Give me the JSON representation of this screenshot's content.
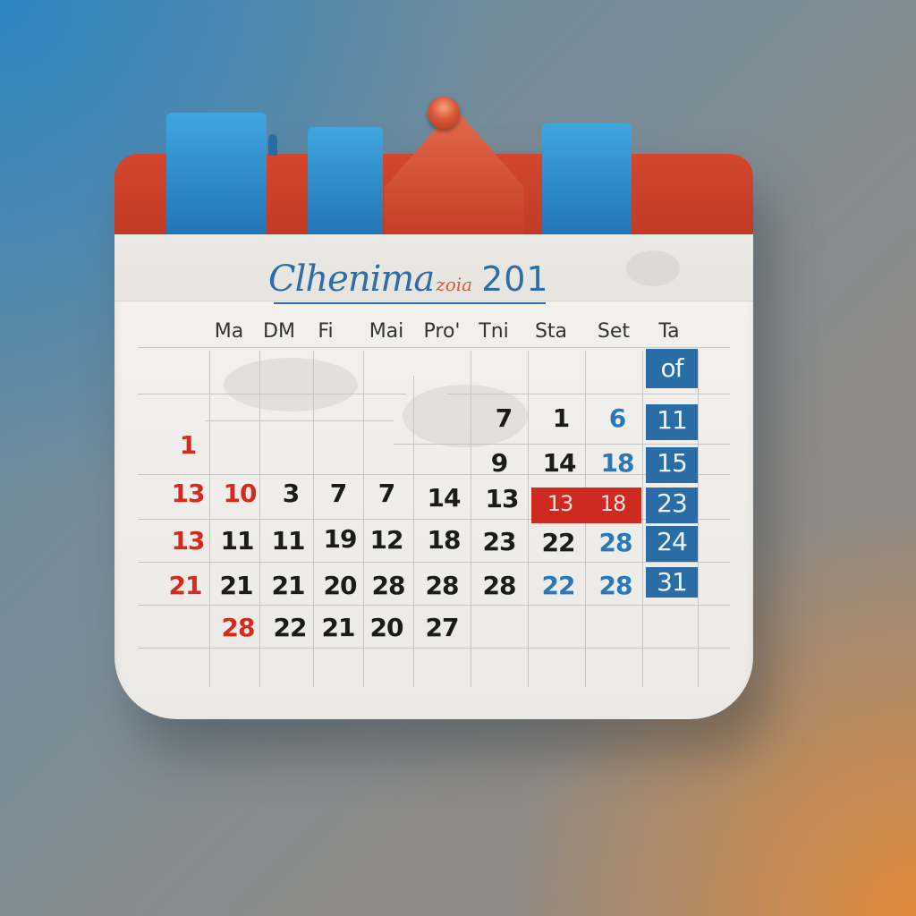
{
  "calendar": {
    "title": "Clhenima",
    "title_accent": "zoia",
    "year": "201",
    "weekdays": [
      "Ma",
      "DM",
      "Fi",
      "Mai",
      "Pro'",
      "Tni",
      "Sta",
      "Set",
      "Ta"
    ],
    "rows": [
      [
        {
          "text": "of",
          "style": "on-blue"
        }
      ],
      [
        {
          "text": "7",
          "style": "black"
        },
        {
          "text": "1",
          "style": "black"
        },
        {
          "text": "6",
          "style": "blue"
        },
        {
          "text": "11",
          "style": "on-blue"
        }
      ],
      [
        {
          "text": "1",
          "style": "red"
        },
        {
          "text": "9",
          "style": "black"
        },
        {
          "text": "14",
          "style": "black"
        },
        {
          "text": "18",
          "style": "blue"
        },
        {
          "text": "15",
          "style": "on-blue"
        }
      ],
      [
        {
          "text": "13",
          "style": "red"
        },
        {
          "text": "10",
          "style": "red"
        },
        {
          "text": "3",
          "style": "black"
        },
        {
          "text": "7",
          "style": "black"
        },
        {
          "text": "7",
          "style": "black"
        },
        {
          "text": "14",
          "style": "black"
        },
        {
          "text": "13",
          "style": "black"
        },
        {
          "text": "13",
          "style": "on-red"
        },
        {
          "text": "18",
          "style": "on-red"
        },
        {
          "text": "23",
          "style": "on-blue"
        }
      ],
      [
        {
          "text": "13",
          "style": "red"
        },
        {
          "text": "11",
          "style": "black"
        },
        {
          "text": "11",
          "style": "black"
        },
        {
          "text": "19",
          "style": "black"
        },
        {
          "text": "12",
          "style": "black"
        },
        {
          "text": "18",
          "style": "black"
        },
        {
          "text": "23",
          "style": "black"
        },
        {
          "text": "22",
          "style": "black"
        },
        {
          "text": "28",
          "style": "blue"
        },
        {
          "text": "24",
          "style": "on-blue"
        }
      ],
      [
        {
          "text": "21",
          "style": "red"
        },
        {
          "text": "21",
          "style": "black"
        },
        {
          "text": "21",
          "style": "black"
        },
        {
          "text": "20",
          "style": "black"
        },
        {
          "text": "28",
          "style": "black"
        },
        {
          "text": "28",
          "style": "black"
        },
        {
          "text": "28",
          "style": "black"
        },
        {
          "text": "22",
          "style": "blue"
        },
        {
          "text": "28",
          "style": "blue"
        },
        {
          "text": "31",
          "style": "on-blue"
        }
      ],
      [
        {
          "text": "28",
          "style": "red"
        },
        {
          "text": "22",
          "style": "black"
        },
        {
          "text": "21",
          "style": "black"
        },
        {
          "text": "20",
          "style": "black"
        },
        {
          "text": "27",
          "style": "black"
        }
      ]
    ]
  },
  "colors": {
    "header_red": "#c8402a",
    "tab_blue": "#2c84c4",
    "weekend_blue": "#2a6da6",
    "highlight_red": "#cf2a1f",
    "date_red": "#d72a1e",
    "date_blue": "#2a78b8"
  }
}
